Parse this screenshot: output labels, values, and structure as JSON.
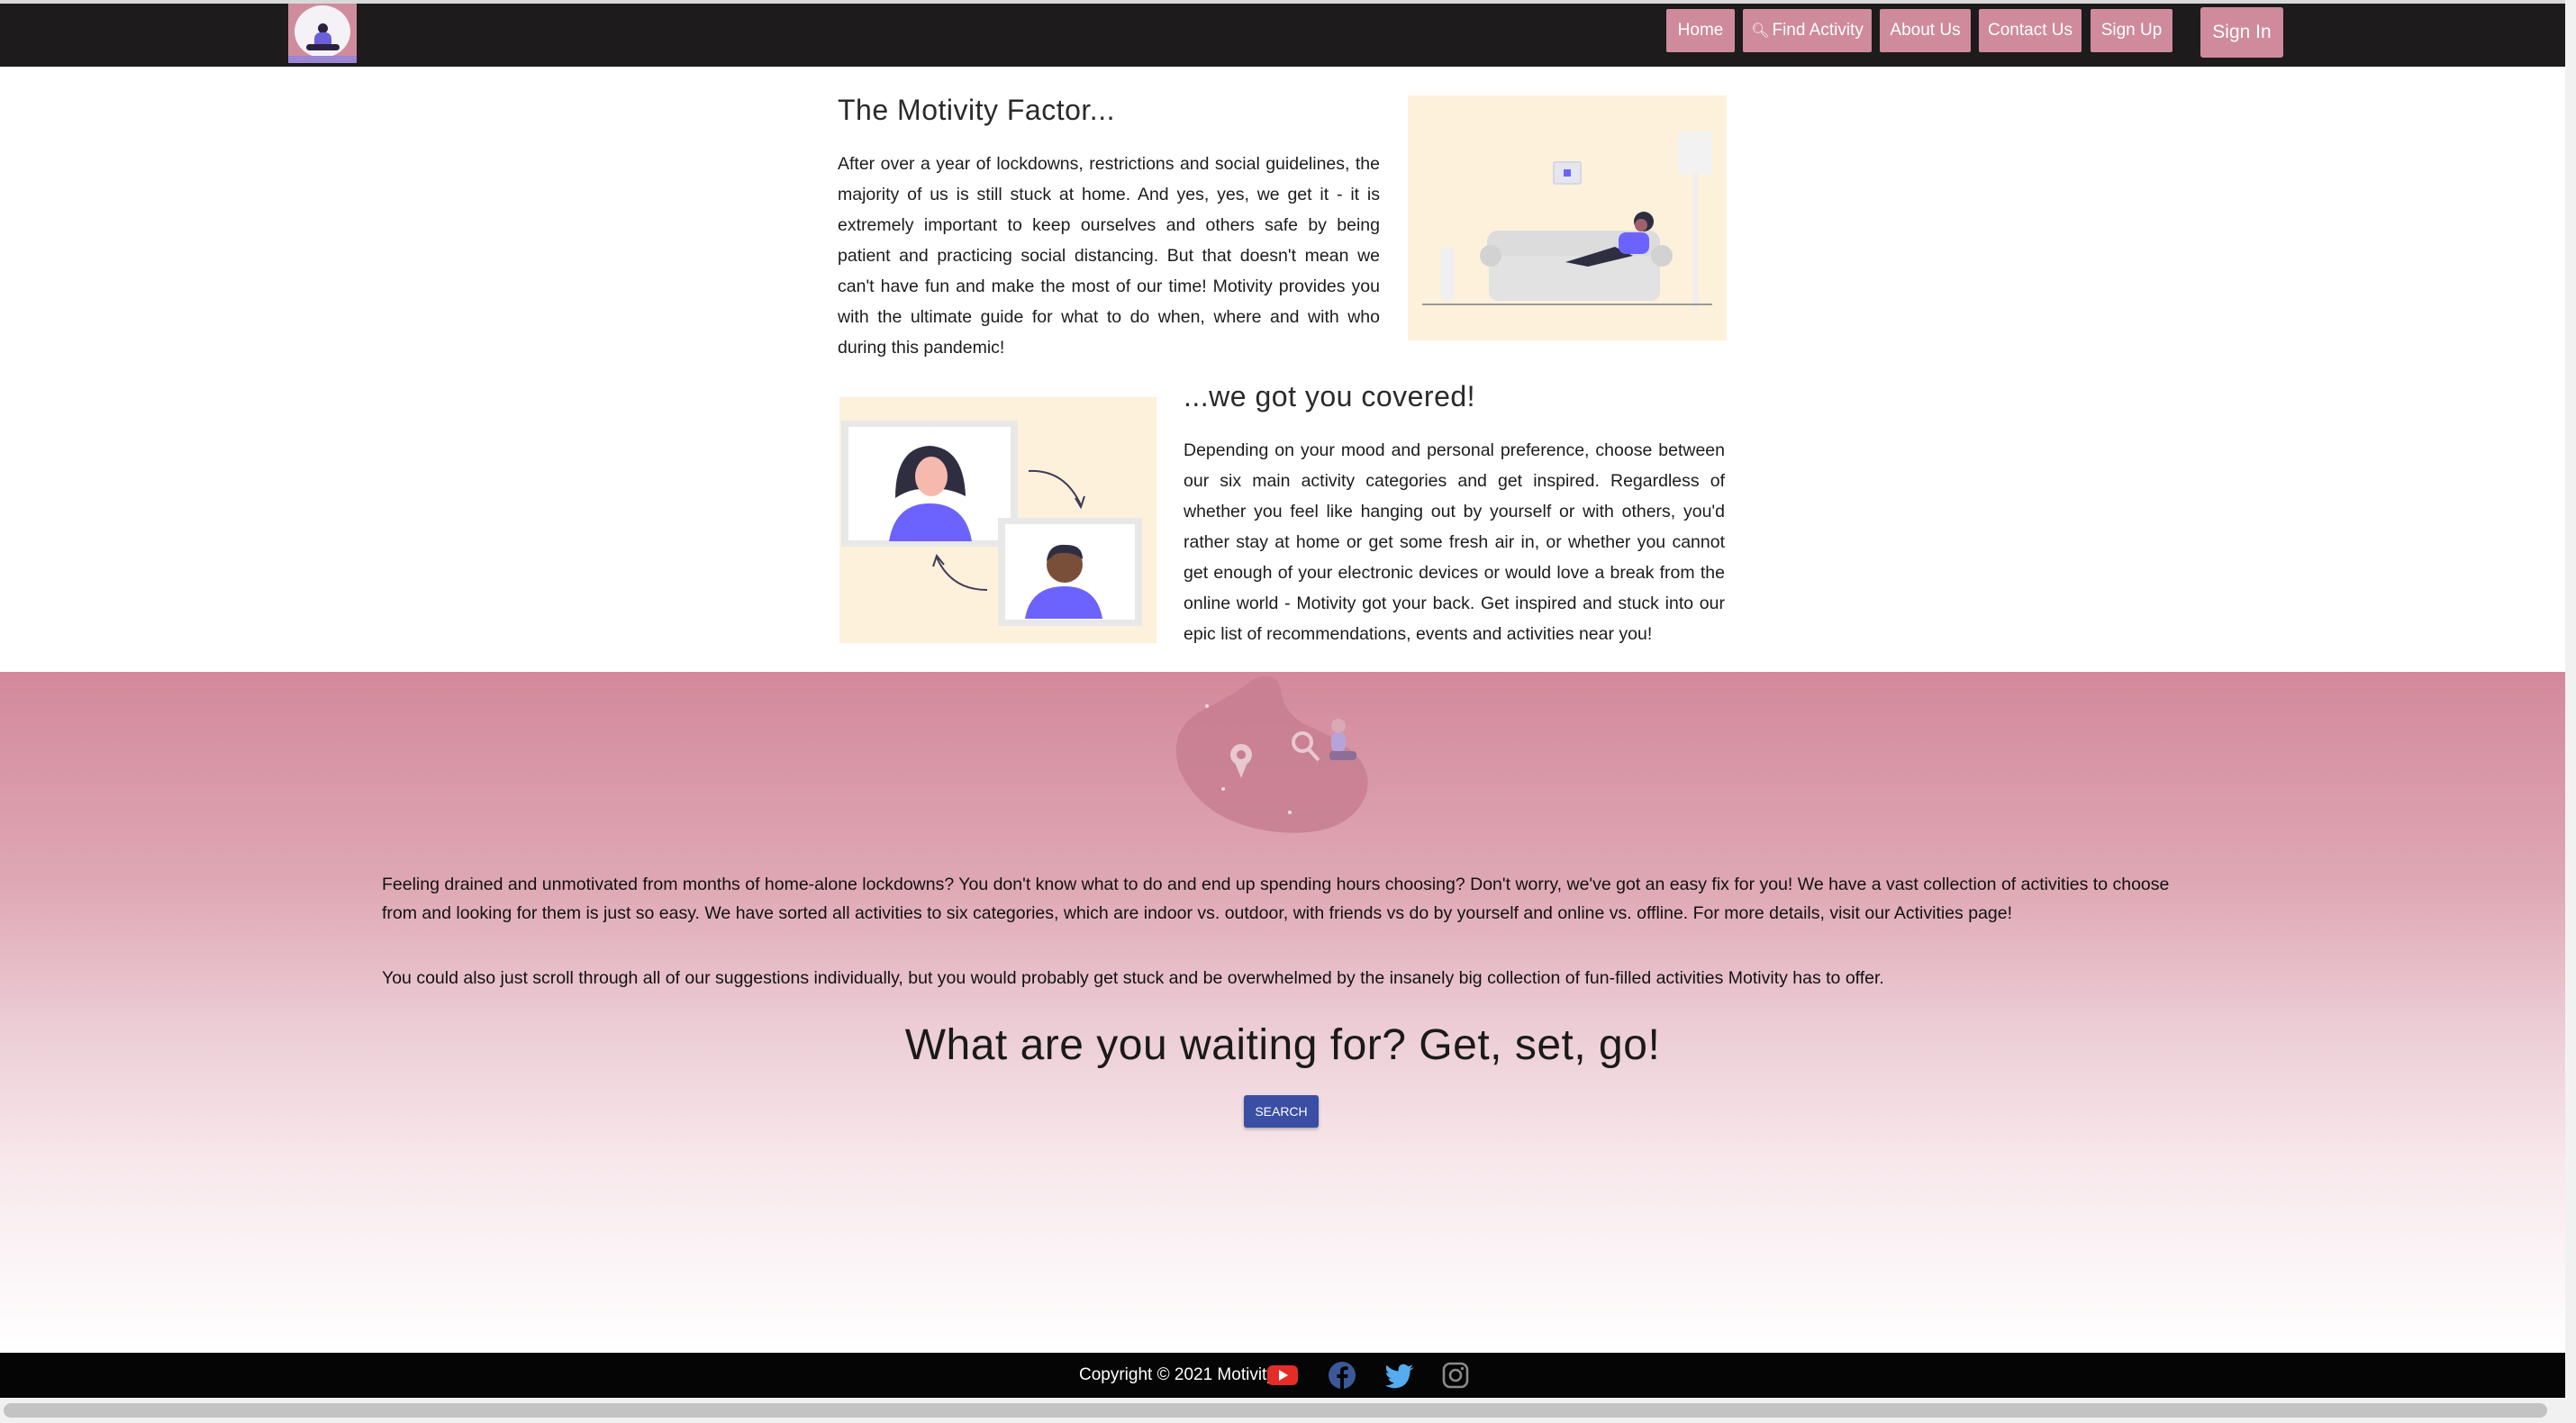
{
  "nav": {
    "items": [
      {
        "label": "Home"
      },
      {
        "label": "Find Activity",
        "icon": "magnifier-icon"
      },
      {
        "label": "About Us"
      },
      {
        "label": "Contact Us"
      },
      {
        "label": "Sign Up"
      }
    ],
    "sign_in": "Sign In"
  },
  "section1": {
    "title": "The Motivity Factor...",
    "body": "After over a year of lockdowns, restrictions and social guidelines, the majority of us is still stuck at home. And yes, yes, we get it - it is extremely important to keep ourselves and others safe by being patient and practicing social distancing. But that doesn't mean we can't have fun and make the most of our time! Motivity provides you with the ultimate guide for what to do when, where and with who during this pandemic!"
  },
  "section2": {
    "title": "...we got you covered!",
    "body": "Depending on your mood and personal preference, choose between our six main activity categories and get inspired. Regardless of whether you feel like hanging out by yourself or with others, you'd rather stay at home or get some fresh air in, or whether you cannot get enough of your electronic devices or would love a break from the online world - Motivity got your back. Get inspired and stuck into our epic list of recommendations, events and activities near you!"
  },
  "band": {
    "para1": "Feeling drained and unmotivated from months of home-alone lockdowns? You don't know what to do and end up spending hours choosing? Don't worry, we've got an easy fix for you! We have a vast collection of activities to choose from and looking for them is just so easy. We have sorted all activities to six categories, which are indoor vs. outdoor, with friends vs do by yourself and online vs. offline. For more details, visit our Activities page!",
    "para2": "You could also just scroll through all of our suggestions individually, but you would probably get stuck and be overwhelmed by the insanely big collection of fun-filled activities Motivity has to offer.",
    "heading": "What are you waiting for? Get, set, go!",
    "search_label": "SEARCH"
  },
  "footer": {
    "copyright": "Copyright © 2021 Motivity",
    "social": [
      "youtube-icon",
      "facebook-icon",
      "twitter-icon",
      "instagram-icon"
    ]
  },
  "colors": {
    "navbar": "#1d1b1c",
    "nav_button": "#cf8a9b",
    "band_top": "#d3899b",
    "search_button": "#3a4ea3",
    "illustration_bg": "#fdf1dc",
    "accent_purple": "#6c63ff"
  }
}
